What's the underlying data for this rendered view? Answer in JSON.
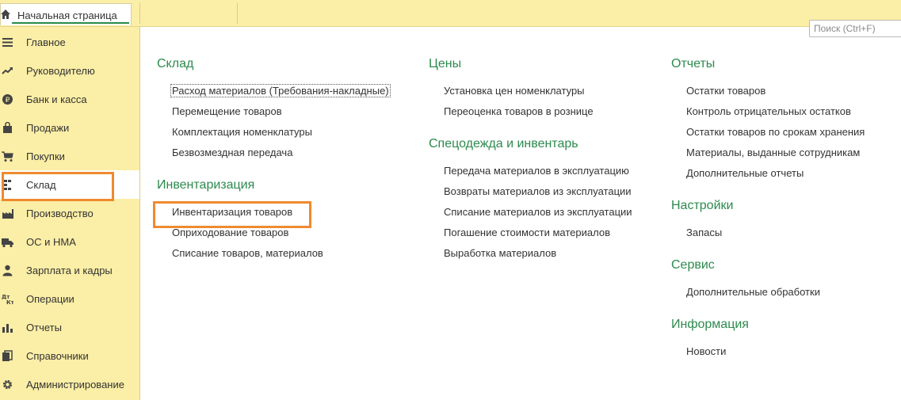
{
  "tab": {
    "home_label": "Начальная страница"
  },
  "search": {
    "placeholder": "Поиск (Ctrl+F)"
  },
  "sidebar": {
    "items": [
      {
        "label": "Главное",
        "icon": "menu-icon"
      },
      {
        "label": "Руководителю",
        "icon": "trend-icon"
      },
      {
        "label": "Банк и касса",
        "icon": "ruble-coin-icon"
      },
      {
        "label": "Продажи",
        "icon": "shopping-bag-icon"
      },
      {
        "label": "Покупки",
        "icon": "cart-icon"
      },
      {
        "label": "Склад",
        "icon": "warehouse-icon"
      },
      {
        "label": "Производство",
        "icon": "factory-icon"
      },
      {
        "label": "ОС и НМА",
        "icon": "truck-icon"
      },
      {
        "label": "Зарплата и кадры",
        "icon": "person-icon"
      },
      {
        "label": "Операции",
        "icon": "dt-kt-icon"
      },
      {
        "label": "Отчеты",
        "icon": "bar-chart-icon"
      },
      {
        "label": "Справочники",
        "icon": "books-icon"
      },
      {
        "label": "Администрирование",
        "icon": "gear-icon"
      }
    ],
    "active_index": 5
  },
  "sections": {
    "sklad": {
      "title": "Склад",
      "links": [
        "Расход материалов (Требования-накладные)",
        "Перемещение товаров",
        "Комплектация номенклатуры",
        "Безвозмездная передача"
      ]
    },
    "inventory": {
      "title": "Инвентаризация",
      "links": [
        "Инвентаризация товаров",
        "Оприходование товаров",
        "Списание товаров, материалов"
      ]
    },
    "prices": {
      "title": "Цены",
      "links": [
        "Установка цен номенклатуры",
        "Переоценка товаров в рознице"
      ]
    },
    "workwear": {
      "title": "Спецодежда и инвентарь",
      "links": [
        "Передача материалов в эксплуатацию",
        "Возвраты материалов из эксплуатации",
        "Списание материалов из эксплуатации",
        "Погашение стоимости материалов",
        "Выработка материалов"
      ]
    },
    "reports": {
      "title": "Отчеты",
      "links": [
        "Остатки товаров",
        "Контроль отрицательных остатков",
        "Остатки товаров по срокам хранения",
        "Материалы, выданные сотрудникам",
        "Дополнительные отчеты"
      ]
    },
    "settings": {
      "title": "Настройки",
      "links": [
        "Запасы"
      ]
    },
    "service": {
      "title": "Сервис",
      "links": [
        "Дополнительные обработки"
      ]
    },
    "info": {
      "title": "Информация",
      "links": [
        "Новости"
      ]
    }
  },
  "colors": {
    "sidebar_bg": "#fbeea6",
    "section_title": "#2d8a4e",
    "highlight": "#ef8a2f"
  }
}
